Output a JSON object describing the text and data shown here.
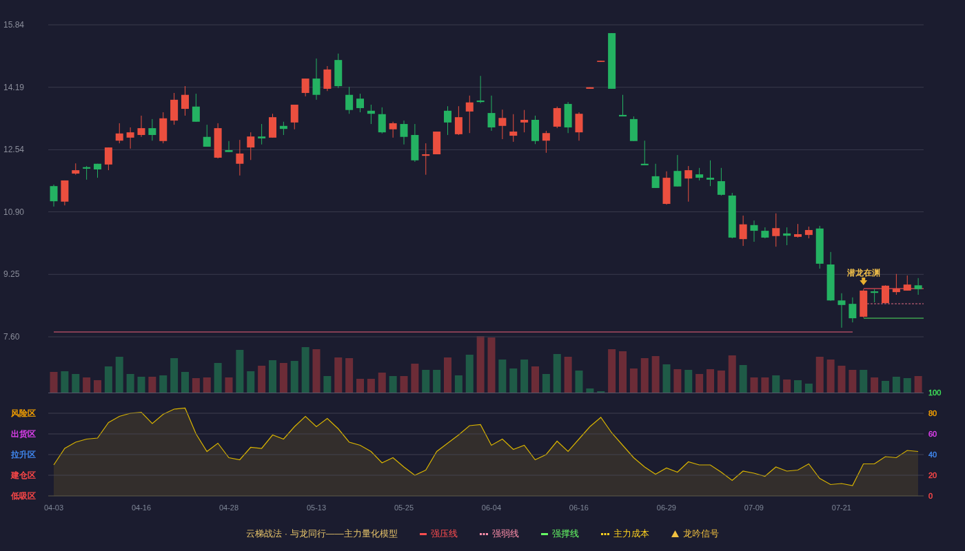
{
  "price_chart": {
    "chart_data": {
      "type": "candlestick",
      "grid": true,
      "ylim": [
        7.6,
        15.84
      ],
      "yticks": [
        {
          "value": 15.84,
          "label": "15.84"
        },
        {
          "value": 14.19,
          "label": "14.19"
        },
        {
          "value": 12.54,
          "label": "12.54"
        },
        {
          "value": 10.9,
          "label": "10.90"
        },
        {
          "value": 9.25,
          "label": "9.25"
        },
        {
          "value": 7.6,
          "label": "7.60"
        }
      ],
      "ohlc": [
        [
          11.58,
          11.62,
          11.04,
          11.18
        ],
        [
          11.17,
          11.73,
          11.07,
          11.73
        ],
        [
          11.91,
          12.18,
          11.88,
          12.0
        ],
        [
          12.08,
          12.11,
          11.75,
          12.04
        ],
        [
          12.17,
          12.17,
          11.8,
          12.02
        ],
        [
          12.15,
          12.6,
          12.0,
          12.6
        ],
        [
          12.78,
          13.24,
          12.71,
          12.97
        ],
        [
          12.86,
          13.13,
          12.57,
          13.0
        ],
        [
          12.93,
          13.44,
          12.88,
          13.11
        ],
        [
          13.11,
          13.35,
          12.78,
          12.93
        ],
        [
          12.77,
          13.53,
          12.71,
          13.37
        ],
        [
          13.31,
          14.04,
          13.2,
          13.86
        ],
        [
          13.62,
          14.22,
          13.44,
          13.99
        ],
        [
          13.68,
          14.02,
          13.28,
          13.28
        ],
        [
          12.88,
          13.2,
          12.62,
          12.62
        ],
        [
          12.33,
          13.24,
          12.31,
          13.11
        ],
        [
          12.53,
          12.77,
          12.48,
          12.48
        ],
        [
          12.17,
          12.8,
          11.86,
          12.44
        ],
        [
          12.6,
          13.0,
          12.27,
          12.89
        ],
        [
          12.89,
          13.22,
          12.68,
          12.84
        ],
        [
          12.86,
          13.49,
          12.86,
          13.4
        ],
        [
          13.17,
          13.28,
          12.93,
          13.09
        ],
        [
          13.26,
          13.73,
          13.08,
          13.73
        ],
        [
          14.04,
          14.42,
          13.95,
          14.42
        ],
        [
          14.42,
          14.95,
          13.86,
          13.99
        ],
        [
          14.15,
          14.75,
          14.09,
          14.66
        ],
        [
          14.91,
          15.08,
          14.17,
          14.22
        ],
        [
          13.99,
          14.2,
          13.49,
          13.59
        ],
        [
          13.89,
          14.02,
          13.53,
          13.64
        ],
        [
          13.57,
          13.73,
          13.22,
          13.49
        ],
        [
          13.48,
          13.66,
          12.97,
          13.0
        ],
        [
          13.08,
          13.28,
          12.86,
          13.24
        ],
        [
          13.22,
          13.31,
          12.68,
          12.88
        ],
        [
          12.93,
          13.22,
          12.22,
          12.26
        ],
        [
          12.38,
          12.71,
          11.88,
          12.42
        ],
        [
          12.42,
          13.02,
          12.42,
          13.02
        ],
        [
          13.57,
          13.69,
          12.93,
          13.26
        ],
        [
          12.95,
          13.69,
          12.93,
          13.4
        ],
        [
          13.55,
          13.97,
          12.98,
          13.79
        ],
        [
          13.84,
          14.49,
          13.77,
          13.8
        ],
        [
          13.51,
          13.97,
          13.04,
          13.13
        ],
        [
          13.17,
          13.6,
          12.82,
          13.38
        ],
        [
          12.91,
          13.48,
          12.75,
          13.02
        ],
        [
          13.26,
          13.59,
          13.0,
          13.33
        ],
        [
          13.33,
          13.44,
          12.69,
          12.77
        ],
        [
          12.78,
          13.04,
          12.46,
          12.98
        ],
        [
          13.15,
          13.68,
          13.11,
          13.64
        ],
        [
          13.75,
          13.8,
          12.98,
          13.13
        ],
        [
          13.0,
          13.53,
          12.78,
          13.49
        ],
        [
          14.15,
          14.19,
          14.15,
          14.19
        ],
        [
          14.86,
          14.89,
          14.86,
          14.89
        ],
        [
          15.62,
          15.62,
          14.15,
          14.15
        ],
        [
          13.46,
          13.99,
          13.42,
          13.42
        ],
        [
          13.35,
          13.42,
          12.77,
          12.77
        ],
        [
          12.17,
          12.78,
          12.13,
          12.13
        ],
        [
          11.84,
          12.17,
          11.53,
          11.53
        ],
        [
          11.11,
          11.97,
          11.09,
          11.8
        ],
        [
          11.98,
          12.4,
          11.57,
          11.57
        ],
        [
          11.78,
          12.11,
          11.17,
          12.0
        ],
        [
          11.89,
          12.06,
          11.73,
          11.8
        ],
        [
          11.8,
          12.26,
          11.58,
          11.75
        ],
        [
          11.71,
          12.06,
          11.33,
          11.35
        ],
        [
          11.33,
          11.4,
          10.2,
          10.22
        ],
        [
          10.18,
          10.8,
          10.0,
          10.57
        ],
        [
          10.55,
          10.67,
          10.11,
          10.4
        ],
        [
          10.4,
          10.49,
          10.2,
          10.22
        ],
        [
          10.26,
          10.86,
          9.98,
          10.47
        ],
        [
          10.33,
          10.49,
          10.02,
          10.27
        ],
        [
          10.24,
          10.58,
          10.22,
          10.31
        ],
        [
          10.29,
          10.51,
          10.2,
          10.42
        ],
        [
          10.46,
          10.53,
          9.4,
          9.53
        ],
        [
          9.51,
          9.84,
          8.55,
          8.56
        ],
        [
          8.56,
          8.75,
          7.84,
          8.44
        ],
        [
          8.47,
          8.64,
          7.98,
          8.09
        ],
        [
          8.13,
          8.86,
          8.11,
          8.82
        ],
        [
          8.8,
          8.86,
          8.51,
          8.76
        ],
        [
          8.49,
          8.96,
          8.49,
          8.95
        ],
        [
          8.78,
          9.26,
          8.71,
          8.87
        ],
        [
          8.82,
          9.22,
          8.82,
          8.98
        ],
        [
          8.96,
          9.15,
          8.71,
          8.86
        ]
      ]
    },
    "signal": {
      "label": "潜龙在渊"
    }
  },
  "indicator": {
    "zones": [
      {
        "label": "风险区",
        "color": "#f5a000"
      },
      {
        "label": "出货区",
        "color": "#e040f0"
      },
      {
        "label": "拉升区",
        "color": "#4088f0"
      },
      {
        "label": "建仓区",
        "color": "#ff4848"
      },
      {
        "label": "低吸区",
        "color": "#ff4848"
      }
    ],
    "axis_ticks": [
      {
        "label": "100",
        "color": "#3ee05a"
      },
      {
        "label": "80",
        "color": "#f5a000"
      },
      {
        "label": "60",
        "color": "#e040f0"
      },
      {
        "label": "40",
        "color": "#4088f0"
      },
      {
        "label": "20",
        "color": "#ff4848"
      },
      {
        "label": "0",
        "color": "#ff4848"
      }
    ],
    "chart_data": {
      "type": "area",
      "grid": true,
      "ylim": [
        0,
        100
      ],
      "yticks": [
        100,
        80,
        60,
        40,
        20,
        0
      ],
      "categories": [
        "04-03",
        null,
        null,
        null,
        null,
        null,
        null,
        null,
        "04-16",
        null,
        null,
        null,
        null,
        null,
        null,
        null,
        "04-28",
        null,
        null,
        null,
        null,
        null,
        null,
        null,
        "05-13",
        null,
        null,
        null,
        null,
        null,
        null,
        null,
        "05-25",
        null,
        null,
        null,
        null,
        null,
        null,
        null,
        "06-04",
        null,
        null,
        null,
        null,
        null,
        null,
        null,
        "06-16",
        null,
        null,
        null,
        null,
        null,
        null,
        null,
        "06-29",
        null,
        null,
        null,
        null,
        null,
        null,
        null,
        "07-09",
        null,
        null,
        null,
        null,
        null,
        null,
        null,
        "07-21",
        null,
        null,
        null,
        null,
        null,
        null,
        null
      ],
      "values": [
        30,
        46,
        52,
        55,
        56,
        71,
        77,
        80,
        81,
        70,
        79,
        84,
        85,
        60,
        43,
        51,
        37,
        35,
        47,
        46,
        59,
        55,
        67,
        77,
        67,
        75,
        65,
        52,
        49,
        43,
        32,
        37,
        28,
        20,
        25,
        43,
        51,
        59,
        68,
        69,
        49,
        55,
        45,
        49,
        35,
        40,
        53,
        43,
        55,
        67,
        76,
        61,
        49,
        37,
        28,
        21,
        27,
        23,
        33,
        30,
        30,
        23,
        15,
        24,
        22,
        19,
        28,
        24,
        25,
        31,
        17,
        11,
        12,
        10,
        31,
        31,
        38,
        37,
        44,
        43
      ]
    }
  },
  "legend": {
    "title": "云梯战法 · 与龙同行——主力量化模型",
    "items": [
      {
        "kind": "line",
        "label": "强压线",
        "color": "#ff4d4f"
      },
      {
        "kind": "dashed",
        "label": "强弱线",
        "color": "#ff8fab"
      },
      {
        "kind": "line",
        "label": "强撑线",
        "color": "#66ff66"
      },
      {
        "kind": "dashed",
        "label": "主力成本",
        "color": "#ffd21f"
      },
      {
        "kind": "triangle",
        "label": "龙吟信号",
        "color": "#f0c040"
      }
    ]
  }
}
